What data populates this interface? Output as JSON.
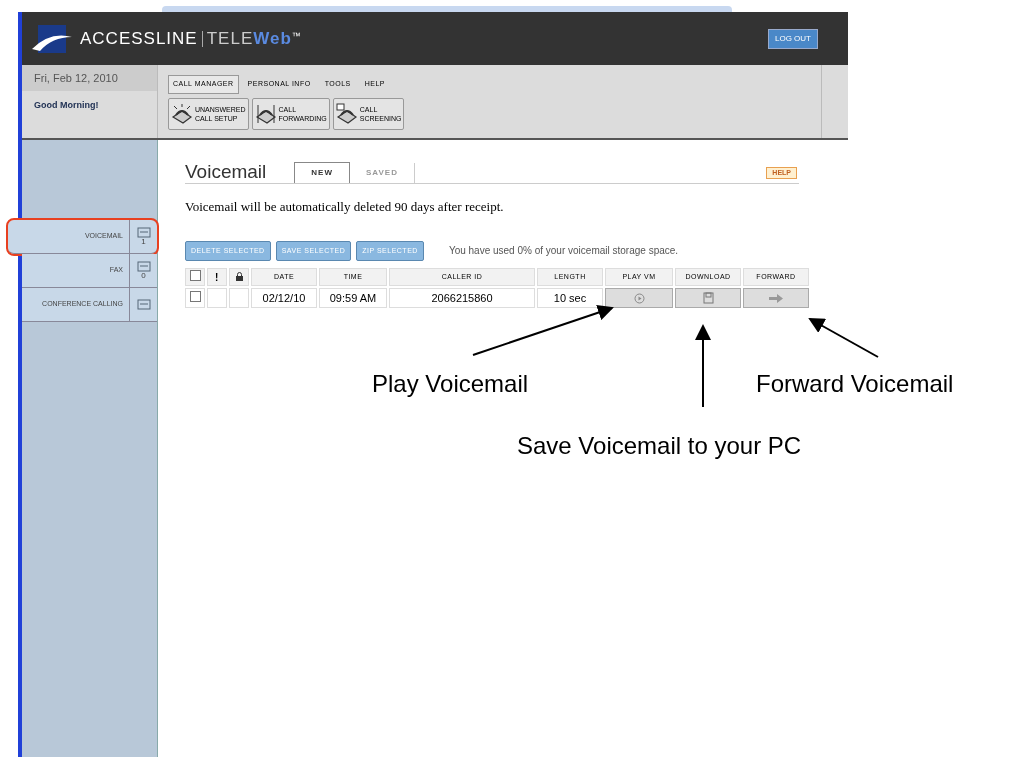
{
  "header": {
    "logo": {
      "brand": "ACCESSLINE",
      "product_a": "TELE",
      "product_b": "Web",
      "mark": "™"
    },
    "logout": "LOG OUT"
  },
  "info": {
    "date": "Fri, Feb 12, 2010",
    "greeting": "Good Morning!"
  },
  "nav_tabs": [
    {
      "label": "CALL MANAGER",
      "selected": true
    },
    {
      "label": "PERSONAL INFO",
      "selected": false
    },
    {
      "label": "TOOLS",
      "selected": false
    },
    {
      "label": "HELP",
      "selected": false
    }
  ],
  "toolbar": [
    {
      "lines": [
        "UNANSWERED",
        "CALL SETUP"
      ]
    },
    {
      "lines": [
        "CALL",
        "FORWARDING"
      ]
    },
    {
      "lines": [
        "CALL",
        "SCREENING"
      ]
    }
  ],
  "sidebar": {
    "items": [
      {
        "label": "VOICEMAIL",
        "count": "1",
        "circled": true
      },
      {
        "label": "FAX",
        "count": "0",
        "circled": false
      },
      {
        "label": "CONFERENCE CALLING",
        "circled": false
      }
    ]
  },
  "content": {
    "title": "Voicemail",
    "tabs": [
      {
        "label": "NEW",
        "selected": true
      },
      {
        "label": "SAVED",
        "selected": false
      }
    ],
    "help": "HELP",
    "notice": "Voicemail will be automatically deleted 90 days after receipt.",
    "actions": [
      "DELETE SELECTED",
      "SAVE SELECTED",
      "ZIP SELECTED"
    ],
    "storage": "You have used 0% of your voicemail storage space.",
    "table": {
      "columns": [
        {
          "kind": "checkbox",
          "checked": false
        },
        {
          "kind": "text",
          "label": "!"
        },
        {
          "kind": "lock"
        },
        {
          "kind": "text",
          "label": "DATE"
        },
        {
          "kind": "text",
          "label": "TIME"
        },
        {
          "kind": "text",
          "label": "CALLER ID"
        },
        {
          "kind": "text",
          "label": "LENGTH"
        },
        {
          "kind": "text",
          "label": "PLAY VM"
        },
        {
          "kind": "text",
          "label": "DOWNLOAD"
        },
        {
          "kind": "text",
          "label": "FORWARD"
        }
      ],
      "rows": [
        {
          "checked": false,
          "date": "02/12/10",
          "time": "09:59 AM",
          "caller_id": "2066215860",
          "length": "10 sec"
        }
      ]
    }
  },
  "annotations": [
    {
      "text": "Play Voicemail"
    },
    {
      "text": "Save Voicemail to your PC"
    },
    {
      "text": "Forward Voicemail"
    }
  ]
}
